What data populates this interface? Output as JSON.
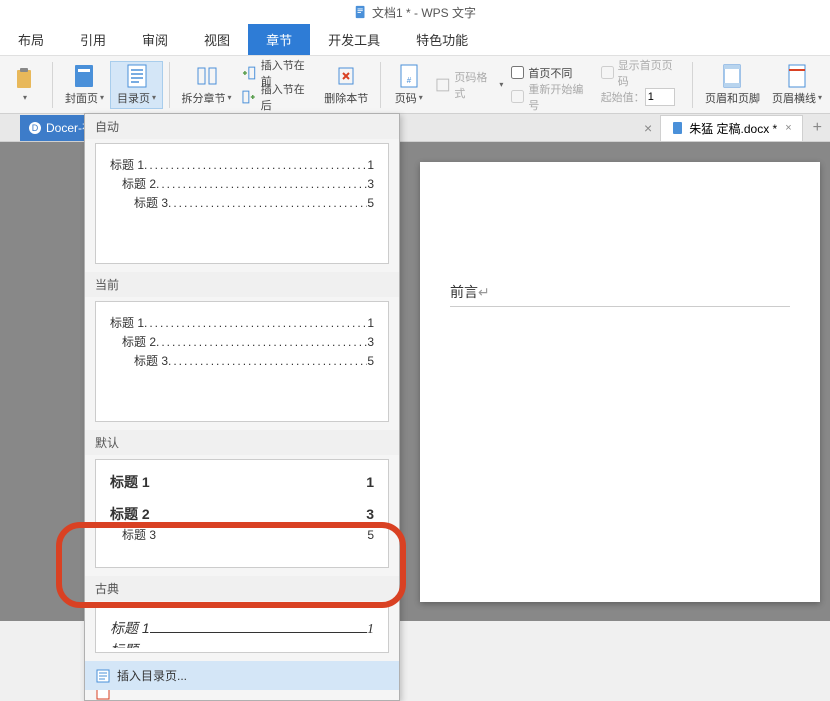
{
  "title": "文档1 * - WPS 文字",
  "menu": {
    "layout": "布局",
    "reference": "引用",
    "review": "审阅",
    "view": "视图",
    "section": "章节",
    "devtools": "开发工具",
    "special": "特色功能"
  },
  "ribbon": {
    "cover": "封面页",
    "toc": "目录页",
    "split_section": "拆分章节",
    "insert_section_before": "插入节在前",
    "insert_section_after": "插入节在后",
    "delete_section": "删除本节",
    "page_number": "页码",
    "page_format": "页码格式",
    "different_first": "首页不同",
    "show_first_page_number": "显示首页页码",
    "restart_numbering": "重新开始编号",
    "start_value_label": "起始值：",
    "start_value": "1",
    "header_footer": "页眉和页脚",
    "header_line": "页眉横线"
  },
  "tabs": {
    "docer": "Docer-在",
    "doc2_name": "朱猛 定稿.docx *"
  },
  "document": {
    "heading": "前言"
  },
  "toc_panel": {
    "auto": "自动",
    "current": "当前",
    "default": "默认",
    "classic": "古典",
    "preview": {
      "h1": "标题 1",
      "h2": "标题 2",
      "h3": "标题 3",
      "p1": "1",
      "p2": "3",
      "p3": "5"
    },
    "classic_preview": {
      "h1": "标题 1",
      "p1": "1"
    },
    "insert_toc": "插入目录页..."
  }
}
